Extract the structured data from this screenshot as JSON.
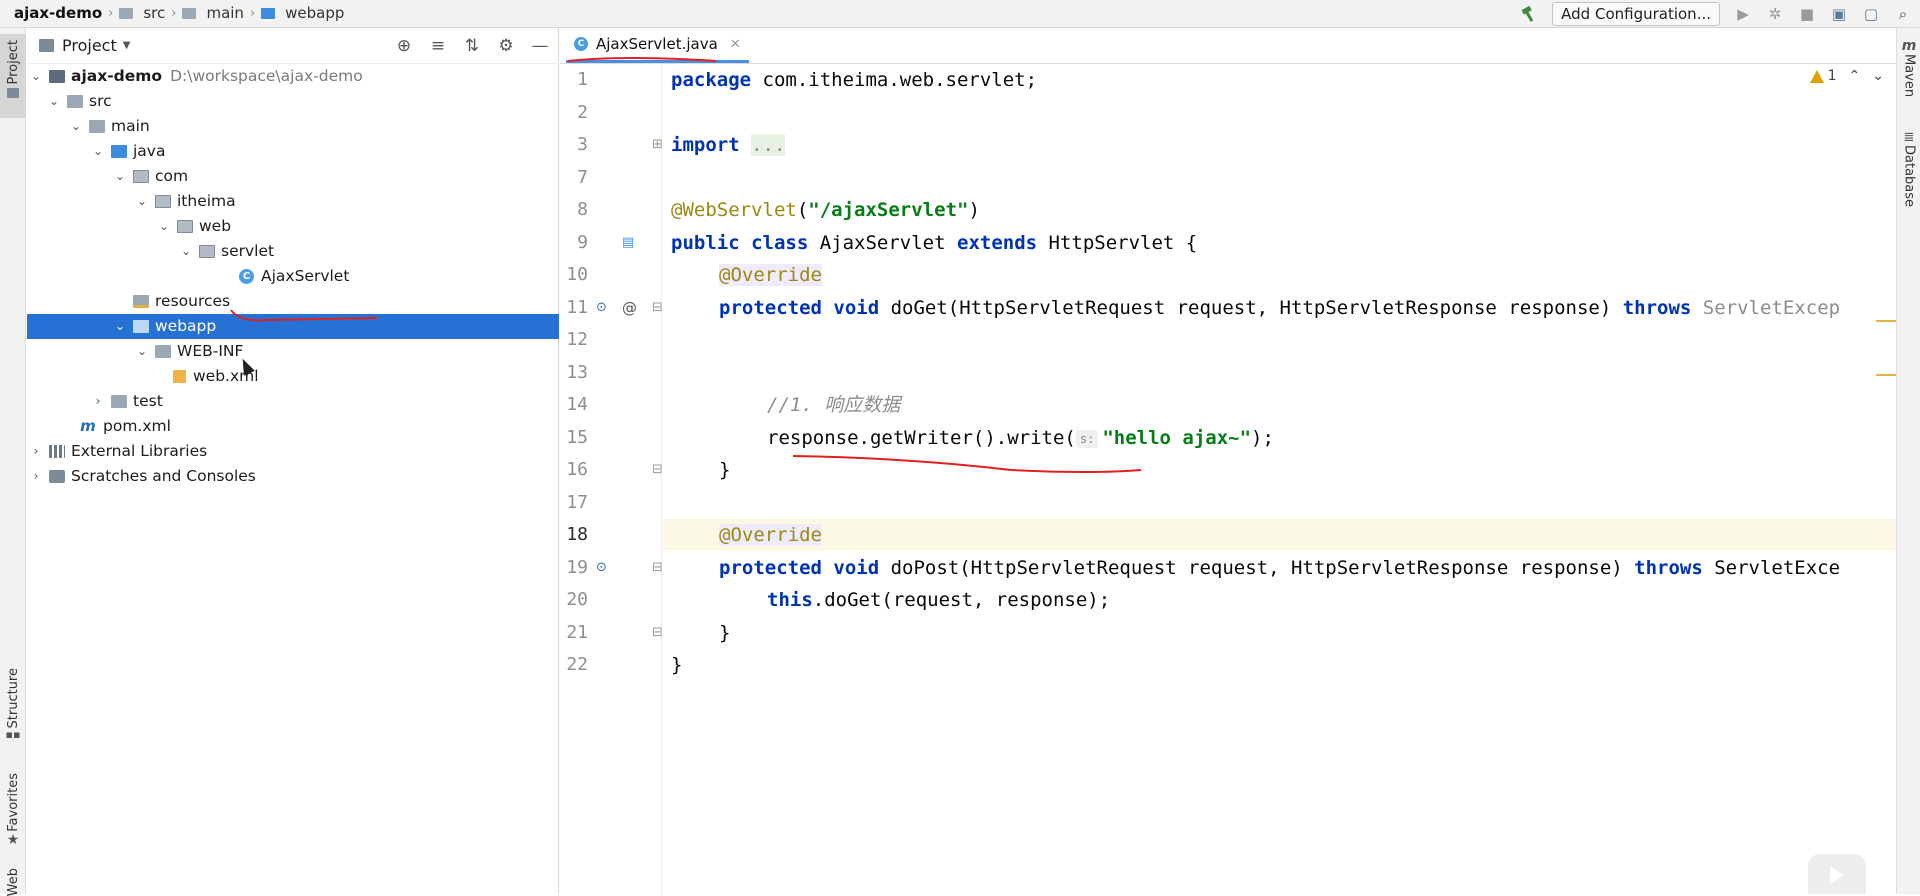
{
  "breadcrumbs": [
    "ajax-demo",
    "src",
    "main",
    "webapp"
  ],
  "toolbar": {
    "add_configuration": "Add Configuration..."
  },
  "left_stripe": {
    "project": "Project",
    "structure": "Structure",
    "favorites": "Favorites",
    "web": "Web"
  },
  "right_stripe": {
    "maven": "Maven",
    "database": "Database"
  },
  "project_panel": {
    "title": "Project",
    "tree": [
      {
        "label": "ajax-demo",
        "hint": "D:\\workspace\\ajax-demo",
        "expanded": true,
        "icon": "module-folder-icon"
      },
      {
        "label": "src",
        "expanded": true,
        "icon": "folder-icon"
      },
      {
        "label": "main",
        "expanded": true,
        "icon": "folder-icon"
      },
      {
        "label": "java",
        "expanded": true,
        "icon": "source-folder-icon"
      },
      {
        "label": "com",
        "expanded": true,
        "icon": "package-icon"
      },
      {
        "label": "itheima",
        "expanded": true,
        "icon": "package-icon"
      },
      {
        "label": "web",
        "expanded": true,
        "icon": "package-icon"
      },
      {
        "label": "servlet",
        "expanded": true,
        "icon": "package-icon"
      },
      {
        "label": "AjaxServlet",
        "icon": "class-icon"
      },
      {
        "label": "resources",
        "icon": "resources-folder-icon"
      },
      {
        "label": "webapp",
        "expanded": true,
        "selected": true,
        "icon": "web-folder-icon"
      },
      {
        "label": "WEB-INF",
        "expanded": true,
        "icon": "folder-icon"
      },
      {
        "label": "web.xml",
        "icon": "xml-file-icon"
      },
      {
        "label": "test",
        "expanded": false,
        "icon": "folder-icon"
      },
      {
        "label": "pom.xml",
        "icon": "maven-icon"
      },
      {
        "label": "External Libraries",
        "expanded": false,
        "icon": "libraries-icon"
      },
      {
        "label": "Scratches and Consoles",
        "expanded": false,
        "icon": "scratches-icon"
      }
    ]
  },
  "editor": {
    "tab_label": "AjaxServlet.java",
    "warning_count": "1",
    "line_numbers": [
      "1",
      "2",
      "3",
      "7",
      "8",
      "9",
      "10",
      "11",
      "12",
      "13",
      "14",
      "15",
      "16",
      "17",
      "18",
      "19",
      "20",
      "21",
      "22"
    ],
    "code": {
      "l1_kw": "package",
      "l1_rest": " com.itheima.web.servlet;",
      "l3_kw": "import",
      "l3_fold": "...",
      "l8_ann": "@WebServlet",
      "l8_open": "(",
      "l8_str": "\"/ajaxServlet\"",
      "l8_close": ")",
      "l9_kw1": "public",
      "l9_kw2": "class",
      "l9_name": " AjaxServlet ",
      "l9_kw3": "extends",
      "l9_rest": " HttpServlet {",
      "l10_ann": "@Override",
      "l11_kw1": "protected",
      "l11_kw2": "void",
      "l11_rest": " doGet(HttpServletRequest request, HttpServletResponse response) ",
      "l11_kw3": "throws",
      "l11_exc": " ServletExcep",
      "l14_cmt": "//1. 响应数据",
      "l15_pre": "response.getWriter().write(",
      "l15_hint": "s:",
      "l15_str": "\"hello ajax~\"",
      "l15_post": ");",
      "l16": "}",
      "l18_ann": "@Override",
      "l19_kw1": "protected",
      "l19_kw2": "void",
      "l19_rest": " doPost(HttpServletRequest request, HttpServletResponse response) ",
      "l19_kw3": "throws",
      "l19_exc": " ServletExce",
      "l20_kw": "this",
      "l20_rest": ".doGet(request, response);",
      "l21": "}",
      "l22": "}"
    }
  }
}
